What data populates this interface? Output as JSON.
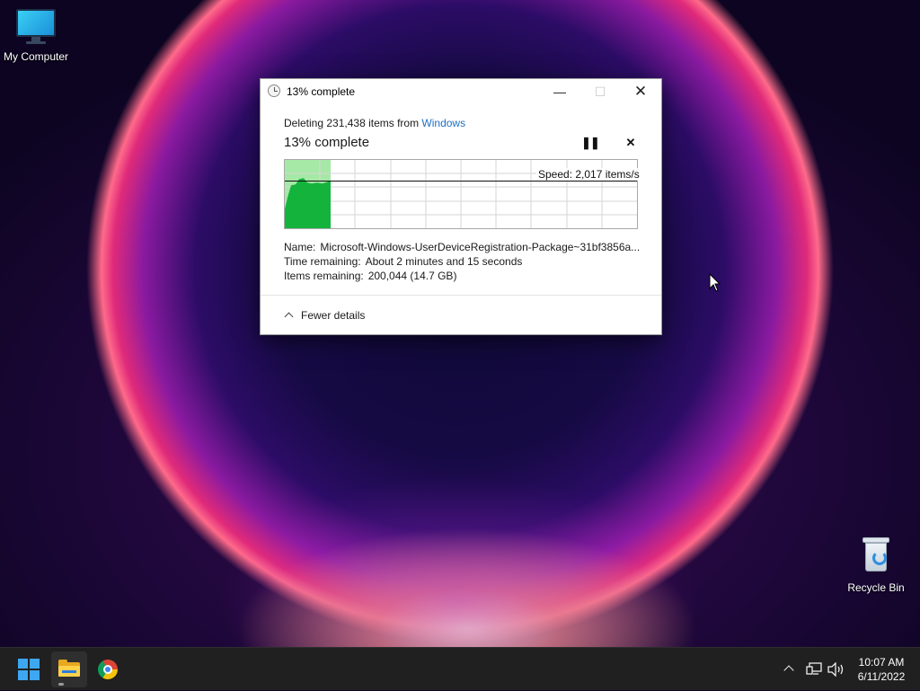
{
  "desktop": {
    "icons": [
      {
        "label": "My Computer",
        "icon": "monitor-icon"
      },
      {
        "label": "Recycle Bin",
        "icon": "recycle-bin-icon"
      }
    ]
  },
  "dialog": {
    "title": "13% complete",
    "title_icon": "clock-icon",
    "minimize_label": "—",
    "maximize_label": "☐",
    "close_label": "✕",
    "deleting_prefix": "Deleting 231,438 items from ",
    "deleting_source": "Windows",
    "progress_heading": "13% complete",
    "progress_fraction": 0.13,
    "pause_label": "❚❚",
    "stop_label": "✕",
    "speed_text": "Speed: 2,017 items/s",
    "speed_line_fraction": 0.68,
    "details": {
      "name_label": "Name:",
      "name_value": "Microsoft-Windows-UserDeviceRegistration-Package~31bf3856a...",
      "time_label": "Time remaining:",
      "time_value": "About 2 minutes and 15 seconds",
      "items_label": "Items remaining:",
      "items_value": "200,044 (14.7 GB)"
    },
    "fewer_details": "Fewer details"
  },
  "taskbar": {
    "apps": [
      {
        "name": "start",
        "icon": "windows-logo-icon"
      },
      {
        "name": "file-explorer",
        "icon": "folder-icon",
        "active": true
      },
      {
        "name": "chrome",
        "icon": "chrome-icon"
      }
    ],
    "tray": {
      "time": "10:07 AM",
      "date": "6/11/2022"
    }
  },
  "colors": {
    "accent": "#1d6fc4",
    "graph_fill": "#14b43c",
    "graph_progress_bg": "#a6e8a6",
    "taskbar": "#202020"
  }
}
